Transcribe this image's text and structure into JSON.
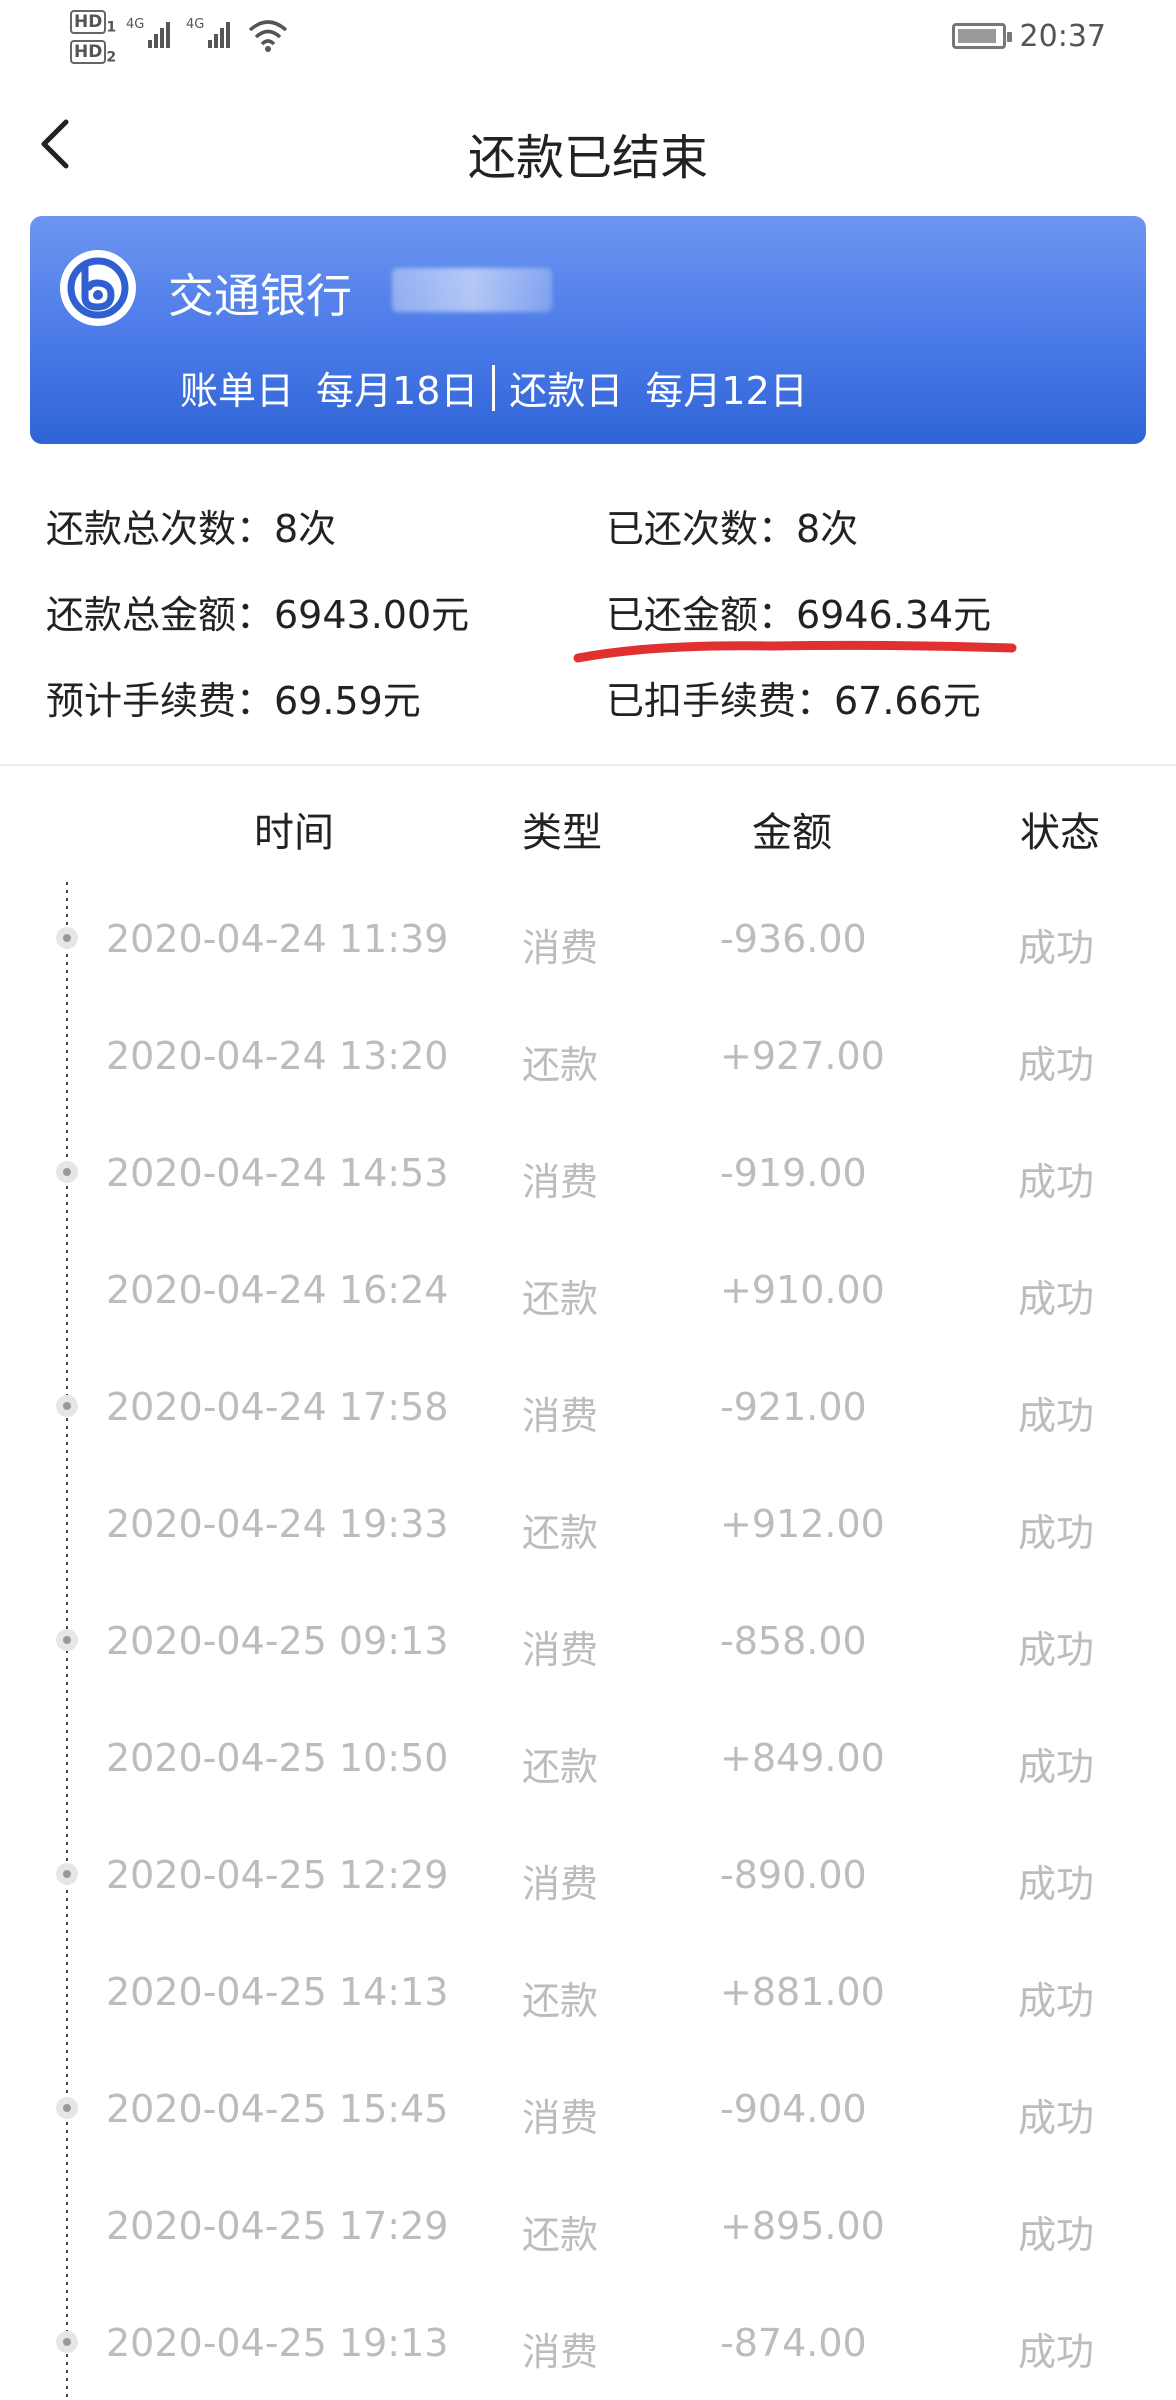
{
  "status_bar": {
    "hd1": "HD",
    "hd1_sub": "1",
    "hd2": "HD",
    "hd2_sub": "2",
    "sig1_label": "4G",
    "sig2_label": "4G",
    "time": "20:37",
    "icons": [
      "signal-icon",
      "wifi-icon",
      "battery-icon"
    ]
  },
  "header": {
    "title": "还款已结束",
    "back_icon": "chevron-left-icon"
  },
  "card": {
    "bank_name": "交通银行",
    "bill_day_label": "账单日",
    "bill_day_value": "每月18日",
    "repay_day_label": "还款日",
    "repay_day_value": "每月12日",
    "colors": {
      "gradient_top": "#6d95f0",
      "gradient_bottom": "#2f63d6"
    }
  },
  "summary": {
    "total_count": "还款总次数：8次",
    "paid_count": "已还次数：8次",
    "total_amount": "还款总金额：6943.00元",
    "paid_amount": "已还金额：6946.34元",
    "est_fee": "预计手续费：69.59元",
    "deducted_fee": "已扣手续费：67.66元"
  },
  "table": {
    "headers": {
      "time": "时间",
      "type": "类型",
      "amount": "金额",
      "status": "状态"
    },
    "rows": [
      {
        "time": "2020-04-24 11:39",
        "type": "消费",
        "amount": "-936.00",
        "status": "成功"
      },
      {
        "time": "2020-04-24 13:20",
        "type": "还款",
        "amount": "+927.00",
        "status": "成功"
      },
      {
        "time": "2020-04-24 14:53",
        "type": "消费",
        "amount": "-919.00",
        "status": "成功"
      },
      {
        "time": "2020-04-24 16:24",
        "type": "还款",
        "amount": "+910.00",
        "status": "成功"
      },
      {
        "time": "2020-04-24 17:58",
        "type": "消费",
        "amount": "-921.00",
        "status": "成功"
      },
      {
        "time": "2020-04-24 19:33",
        "type": "还款",
        "amount": "+912.00",
        "status": "成功"
      },
      {
        "time": "2020-04-25 09:13",
        "type": "消费",
        "amount": "-858.00",
        "status": "成功"
      },
      {
        "time": "2020-04-25 10:50",
        "type": "还款",
        "amount": "+849.00",
        "status": "成功"
      },
      {
        "time": "2020-04-25 12:29",
        "type": "消费",
        "amount": "-890.00",
        "status": "成功"
      },
      {
        "time": "2020-04-25 14:13",
        "type": "还款",
        "amount": "+881.00",
        "status": "成功"
      },
      {
        "time": "2020-04-25 15:45",
        "type": "消费",
        "amount": "-904.00",
        "status": "成功"
      },
      {
        "time": "2020-04-25 17:29",
        "type": "还款",
        "amount": "+895.00",
        "status": "成功"
      },
      {
        "time": "2020-04-25 19:13",
        "type": "消费",
        "amount": "-874.00",
        "status": "成功"
      }
    ]
  }
}
